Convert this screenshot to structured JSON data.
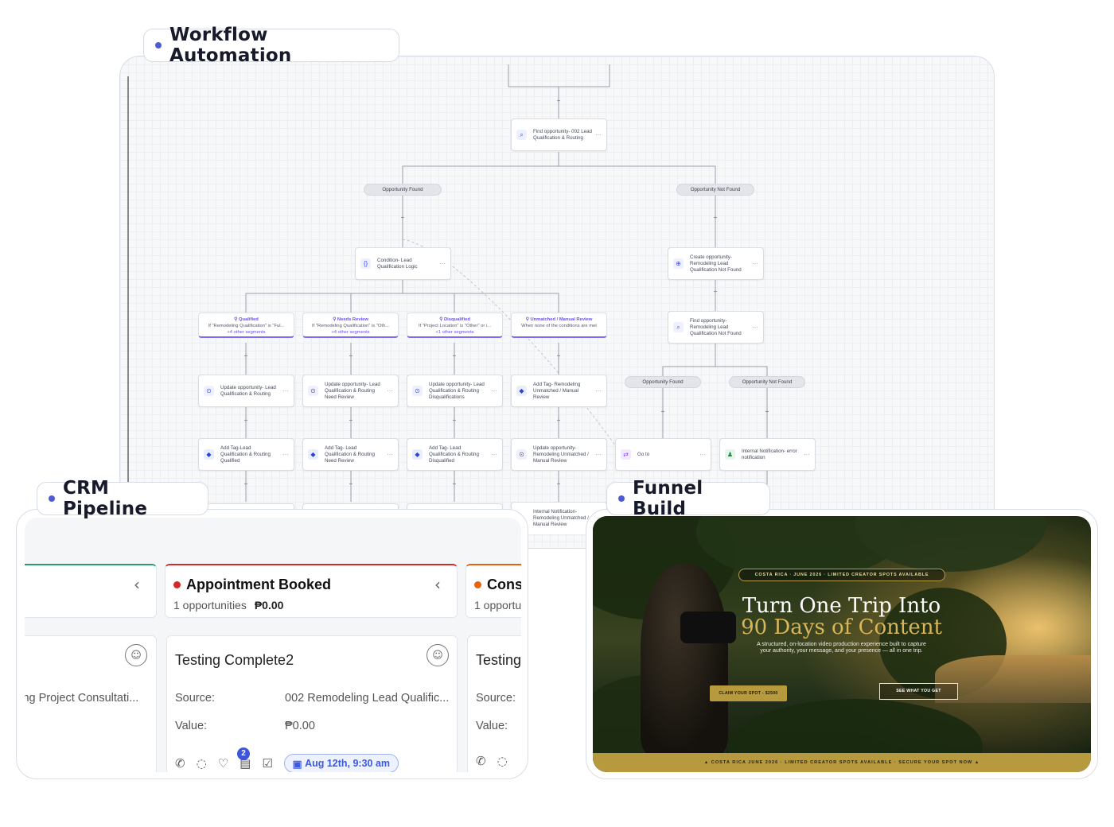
{
  "labels": {
    "workflow": "Workflow Automation",
    "crm": "CRM Pipeline",
    "funnel": "Funnel Build"
  },
  "workflow": {
    "nodes": {
      "find_opportunity": "Find opportunity- 002 Lead Qualification & Routing",
      "condition": "Condition- Lead Qualification Logic",
      "create_opportunity": "Create opportunity- Remodeling Lead Qualification Not Found",
      "find_opportunity_2": "Find opportunity- Remodeling Lead Qualification Not Found",
      "update_1": "Update opportunity- Lead Qualification & Routing",
      "update_2": "Update opportunity- Lead Qualification & Routing Need Review",
      "update_3": "Update opportunity- Lead Qualification & Routing Disqualifications",
      "addtag_4": "Add Tag- Remodeling Unmatched / Manual Review",
      "addtag_1": "Add Tag-Lead Qualification & Routing Qualified",
      "addtag_2": "Add Tag- Lead Qualification & Routing Need Review",
      "addtag_3": "Add Tag- Lead Qualification & Routing Disqualified",
      "update_4": "Update opportunity- Remodeling Unmatched / Manual Review",
      "goto": "Go to",
      "internal_notification": "Internal Notification- error notification",
      "internal_notification_2": "Internal Notification- Remodeling Unmatched / Manual Review"
    },
    "branches": {
      "found": "Opportunity Found",
      "not_found": "Opportunity Not Found",
      "found_2": "Opportunity Found",
      "not_found_2": "Opportunity Not Found"
    },
    "conditions": [
      {
        "title": "Qualified",
        "rule": "If \"Remodeling Qualification\" is \"Ful...",
        "more": "+4 other segments"
      },
      {
        "title": "Needs Review",
        "rule": "If \"Remodeling Qualification\" is \"Oth...",
        "more": "+4 other segments"
      },
      {
        "title": "Disqualified",
        "rule": "If \"Project Location\" is \"Other\" or i...",
        "more": "+1 other segments"
      },
      {
        "title": "Unmatched / Manual Review",
        "rule": "When none of the conditions are met",
        "more": ""
      }
    ]
  },
  "crm": {
    "stage_main": {
      "title": "Appointment Booked",
      "count": "1 opportunities",
      "amount": "₱0.00",
      "color": "#d62828"
    },
    "stage_right": {
      "title": "Cons",
      "count": "1 opportu",
      "color": "#e8620c"
    },
    "card_left": {
      "source_value": "ling Project Consultati..."
    },
    "card_main": {
      "title": "Testing Complete2",
      "source_label": "Source:",
      "source_value": "002 Remodeling Lead Qualific...",
      "value_label": "Value:",
      "value": "₱0.00",
      "badge": "2",
      "date": "Aug 12th, 9:30 am"
    },
    "card_right": {
      "title": "Testing",
      "source_label": "Source:",
      "value_label": "Value:"
    }
  },
  "funnel": {
    "top_chip": "COSTA RICA · JUNE 2026 · LIMITED CREATOR SPOTS AVAILABLE",
    "headline": "Turn One Trip Into",
    "headline_gold": "90 Days of Content",
    "description": "A structured, on-location video production experience built to capture your authority, your message, and your presence — all in one trip.",
    "cta_primary": "CLAIM YOUR SPOT - $2500",
    "cta_secondary": "SEE WHAT YOU GET",
    "bottom_bar": "▲ COSTA RICA JUNE 2026 · LIMITED CREATOR SPOTS AVAILABLE · SECURE YOUR SPOT NOW ▲",
    "accent": "#b89a3e"
  }
}
